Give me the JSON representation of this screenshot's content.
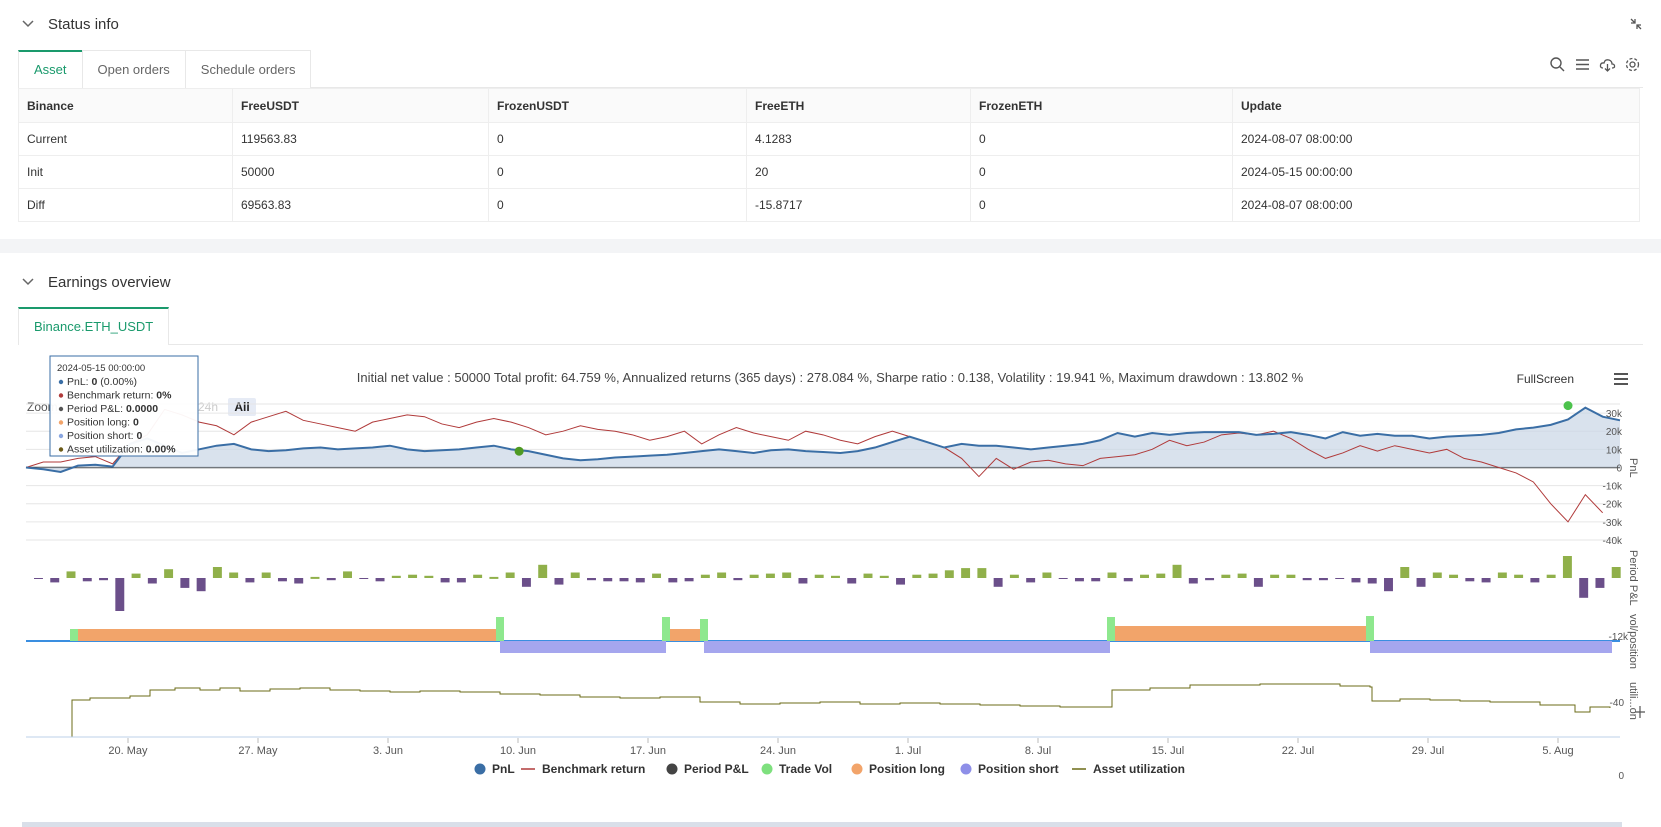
{
  "status_section": {
    "title": "Status info"
  },
  "asset_tabs": [
    "Asset",
    "Open orders",
    "Schedule orders"
  ],
  "asset_table": {
    "headers": [
      "Binance",
      "FreeUSDT",
      "FrozenUSDT",
      "FreeETH",
      "FrozenETH",
      "Update"
    ],
    "rows": [
      [
        "Current",
        "119563.83",
        "0",
        "4.1283",
        "0",
        "2024-08-07 08:00:00"
      ],
      [
        "Init",
        "50000",
        "0",
        "20",
        "0",
        "2024-05-15 00:00:00"
      ],
      [
        "Diff",
        "69563.83",
        "0",
        "-15.8717",
        "0",
        "2024-08-07 08:00:00"
      ]
    ]
  },
  "earnings_section": {
    "title": "Earnings overview"
  },
  "earnings_tab": "Binance.ETH_USDT",
  "summary": "Initial net value : 50000 Total profit: 64.759 %, Annualized returns (365 days) : 278.084 %, Sharpe ratio : 0.138, Volatility : 19.941 %, Maximum drawdown : 13.802 %",
  "fullscreen_label": "FullScreen",
  "zoom": {
    "label": "Zoom",
    "buttons": [
      "24h",
      "All"
    ],
    "active": "All"
  },
  "tooltip": {
    "date": "2024-05-15 00:00:00",
    "rows": [
      {
        "label": "PnL: ",
        "value": "0",
        "extra": " (0.00%)",
        "color": "#3a6ea5"
      },
      {
        "label": "Benchmark return: ",
        "value": "0%",
        "extra": "",
        "color": "#b03a3a"
      },
      {
        "label": "Period P&L: ",
        "value": "0.0000",
        "extra": "",
        "color": "#555"
      },
      {
        "label": "Position long: ",
        "value": "0",
        "extra": "",
        "color": "#f2a46a"
      },
      {
        "label": "Position short: ",
        "value": "0",
        "extra": "",
        "color": "#8aa6e0"
      },
      {
        "label": "Asset utilization: ",
        "value": "0.00%",
        "extra": "",
        "color": "#6b5a17"
      }
    ]
  },
  "chart_data": {
    "type": "line",
    "x_ticks": [
      "20. May",
      "27. May",
      "3. Jun",
      "10. Jun",
      "17. Jun",
      "24. Jun",
      "1. Jul",
      "8. Jul",
      "15. Jul",
      "22. Jul",
      "29. Jul",
      "5. Aug"
    ],
    "pnl_axis": {
      "label": "PnL",
      "ticks": [
        "30k",
        "20k",
        "10k",
        "0",
        "-10k",
        "-20k",
        "-30k",
        "-40k"
      ],
      "ylim": [
        -40000,
        35000
      ]
    },
    "period_axis": {
      "label": "Period P&L",
      "ticks": [
        "-12k"
      ]
    },
    "position_axis": {
      "label": "vol/position",
      "ticks": [
        "-40"
      ]
    },
    "util_axis": {
      "label": "utili...on",
      "ticks": [
        "0"
      ]
    },
    "pnl": [
      0,
      -1000,
      -2500,
      1000,
      1500,
      500,
      13000,
      16000,
      12000,
      8000,
      10000,
      12000,
      13000,
      10000,
      9000,
      9500,
      10500,
      11000,
      10000,
      10500,
      11000,
      12000,
      10000,
      9000,
      9500,
      10000,
      11000,
      12000,
      10000,
      9000,
      7000,
      5000,
      4000,
      4500,
      5500,
      6000,
      6500,
      7000,
      8000,
      9000,
      10000,
      9000,
      8000,
      9500,
      10000,
      9000,
      8500,
      8000,
      9000,
      11000,
      14000,
      17000,
      14000,
      11000,
      13000,
      12000,
      12000,
      11000,
      10000,
      11000,
      12000,
      13000,
      15000,
      19000,
      17000,
      19000,
      18000,
      19000,
      19500,
      19500,
      19500,
      18000,
      18500,
      19500,
      18000,
      16000,
      19500,
      17500,
      18500,
      17500,
      17500,
      16000,
      17000,
      17500,
      18000,
      19000,
      21000,
      22000,
      23500,
      26500,
      33000,
      28000,
      26000
    ],
    "benchmark": [
      0,
      3000,
      3000,
      5000,
      6000,
      2000,
      13000,
      18000,
      32000,
      29000,
      25000,
      23000,
      18000,
      25000,
      28000,
      31000,
      26000,
      24000,
      22000,
      20000,
      25000,
      27000,
      29000,
      28000,
      24000,
      22000,
      25000,
      27000,
      25000,
      22000,
      18000,
      20000,
      23000,
      21000,
      20000,
      18000,
      15000,
      17000,
      20000,
      13000,
      18000,
      22000,
      19000,
      17000,
      15000,
      20000,
      18000,
      15000,
      13000,
      17000,
      20000,
      17000,
      14000,
      11000,
      5000,
      -5000,
      5000,
      -1000,
      3000,
      4000,
      2000,
      1000,
      5000,
      6000,
      7000,
      10000,
      15000,
      12000,
      14000,
      18000,
      19000,
      18000,
      20000,
      16000,
      10000,
      5000,
      8000,
      12000,
      9000,
      12000,
      10000,
      8000,
      10000,
      5000,
      3000,
      0,
      -3000,
      -8000,
      -20000,
      -30000,
      -15000,
      -25000
    ],
    "series_names": [
      "PnL",
      "Benchmark return",
      "Period P&L",
      "Trade Vol",
      "Position long",
      "Position short",
      "Asset utilization"
    ],
    "series_colors": [
      "#3a6ea5",
      "#b03a3a",
      "#444444",
      "#7ee07e",
      "#f2a46a",
      "#8e8fe8",
      "#6b6b17"
    ]
  }
}
